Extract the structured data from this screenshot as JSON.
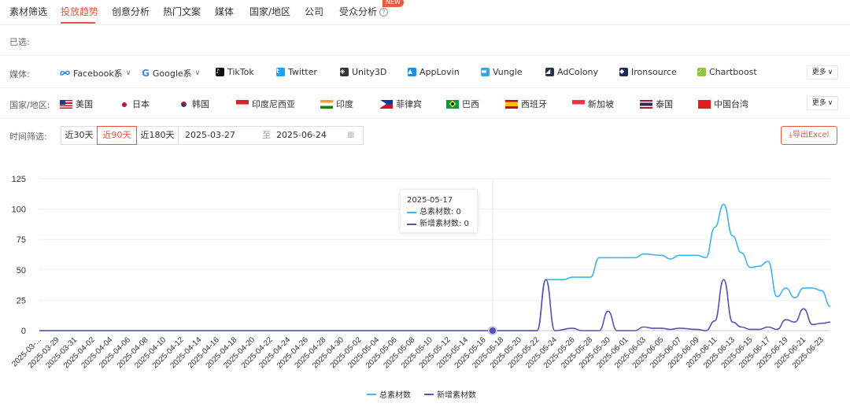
{
  "tabs": [
    {
      "label": "素材筛选"
    },
    {
      "label": "投放趋势"
    },
    {
      "label": "创意分析"
    },
    {
      "label": "热门文案"
    },
    {
      "label": "媒体"
    },
    {
      "label": "国家/地区"
    },
    {
      "label": "公司"
    },
    {
      "label": "受众分析"
    }
  ],
  "new_badge": "NEW",
  "selected_label": "已选:",
  "media": {
    "label": "媒体:",
    "items": [
      {
        "label": "Facebook系",
        "icon": "meta-icon"
      },
      {
        "label": "Google系",
        "icon": "google-icon"
      },
      {
        "label": "TikTok",
        "icon": "tiktok-icon"
      },
      {
        "label": "Twitter",
        "icon": "twitter-icon"
      },
      {
        "label": "Unity3D",
        "icon": "unity-icon"
      },
      {
        "label": "AppLovin",
        "icon": "applovin-icon"
      },
      {
        "label": "Vungle",
        "icon": "vungle-icon"
      },
      {
        "label": "AdColony",
        "icon": "adcolony-icon"
      },
      {
        "label": "Ironsource",
        "icon": "ironsource-icon"
      },
      {
        "label": "Chartboost",
        "icon": "chartboost-icon"
      }
    ],
    "more": "更多"
  },
  "country": {
    "label": "国家/地区:",
    "items": [
      {
        "label": "美国",
        "icon": "us-flag-icon"
      },
      {
        "label": "日本",
        "icon": "japan-flag-icon"
      },
      {
        "label": "韩国",
        "icon": "korea-flag-icon"
      },
      {
        "label": "印度尼西亚",
        "icon": "indonesia-flag-icon"
      },
      {
        "label": "印度",
        "icon": "india-flag-icon"
      },
      {
        "label": "菲律宾",
        "icon": "philippines-flag-icon"
      },
      {
        "label": "巴西",
        "icon": "brazil-flag-icon"
      },
      {
        "label": "西班牙",
        "icon": "spain-flag-icon"
      },
      {
        "label": "新加坡",
        "icon": "singapore-flag-icon"
      },
      {
        "label": "泰国",
        "icon": "thailand-flag-icon"
      },
      {
        "label": "中国台湾",
        "icon": "taiwan-flag-icon"
      }
    ],
    "more": "更多"
  },
  "time": {
    "label": "时间筛选:",
    "options": [
      "近30天",
      "近90天",
      "近180天"
    ],
    "selected": "近90天",
    "start_date": "2025-03-27",
    "separator": "至",
    "end_date": "2025-06-24"
  },
  "export_label": "导出Excel",
  "colors": {
    "accent": "#e8553c",
    "series_total": "#3fb4ef",
    "series_new": "#5b4fb8"
  },
  "tooltip": {
    "date": "2025-05-17",
    "rows": [
      {
        "label": "总素材数: 0",
        "color": "#3fb4ef"
      },
      {
        "label": "新增素材数: 0",
        "color": "#5b4fb8"
      }
    ]
  },
  "chart_data": {
    "type": "line",
    "x_start": "2025-03-27",
    "x_end": "2025-06-24",
    "x_tick_labels": [
      "2025-03-...",
      "2025-03-29",
      "2025-03-31",
      "2025-04-02",
      "2025-04-04",
      "2025-04-06",
      "2025-04-08",
      "2025-04-10",
      "2025-04-12",
      "2025-04-14",
      "2025-04-16",
      "2025-04-18",
      "2025-04-20",
      "2025-04-22",
      "2025-04-24",
      "2025-04-26",
      "2025-04-28",
      "2025-04-30",
      "2025-05-02",
      "2025-05-04",
      "2025-05-06",
      "2025-05-08",
      "2025-05-10",
      "2025-05-12",
      "2025-05-14",
      "2025-05-16",
      "2025-05-18",
      "2025-05-20",
      "2025-05-22",
      "2025-05-24",
      "2025-05-26",
      "2025-05-28",
      "2025-05-30",
      "2025-06-01",
      "2025-06-03",
      "2025-06-05",
      "2025-06-07",
      "2025-06-09",
      "2025-06-11",
      "2025-06-13",
      "2025-06-15",
      "2025-06-17",
      "2025-06-19",
      "2025-06-21",
      "2025-06-23"
    ],
    "y_ticks": [
      0,
      25,
      50,
      75,
      100,
      125
    ],
    "ylim": [
      0,
      125
    ],
    "highlight_date": "2025-05-17",
    "legend_position": "bottom-center",
    "series": [
      {
        "name": "总素材数",
        "points": [
          [
            "2025-03-27",
            0
          ],
          [
            "2025-05-17",
            0
          ],
          [
            "2025-05-22",
            0
          ],
          [
            "2025-05-23",
            42
          ],
          [
            "2025-05-25",
            42
          ],
          [
            "2025-05-26",
            44
          ],
          [
            "2025-05-28",
            44
          ],
          [
            "2025-05-29",
            60
          ],
          [
            "2025-06-02",
            60
          ],
          [
            "2025-06-03",
            63
          ],
          [
            "2025-06-05",
            62
          ],
          [
            "2025-06-06",
            59
          ],
          [
            "2025-06-07",
            62
          ],
          [
            "2025-06-09",
            62
          ],
          [
            "2025-06-10",
            60
          ],
          [
            "2025-06-11",
            85
          ],
          [
            "2025-06-12",
            104
          ],
          [
            "2025-06-13",
            78
          ],
          [
            "2025-06-14",
            64
          ],
          [
            "2025-06-15",
            52
          ],
          [
            "2025-06-16",
            53
          ],
          [
            "2025-06-17",
            57
          ],
          [
            "2025-06-18",
            28
          ],
          [
            "2025-06-19",
            35
          ],
          [
            "2025-06-20",
            27
          ],
          [
            "2025-06-21",
            35
          ],
          [
            "2025-06-22",
            35
          ],
          [
            "2025-06-23",
            33
          ],
          [
            "2025-06-24",
            20
          ]
        ]
      },
      {
        "name": "新增素材数",
        "points": [
          [
            "2025-03-27",
            0
          ],
          [
            "2025-05-17",
            0
          ],
          [
            "2025-05-22",
            0
          ],
          [
            "2025-05-23",
            42
          ],
          [
            "2025-05-24",
            0
          ],
          [
            "2025-05-26",
            2
          ],
          [
            "2025-05-27",
            0
          ],
          [
            "2025-05-29",
            0
          ],
          [
            "2025-05-30",
            16
          ],
          [
            "2025-05-31",
            0
          ],
          [
            "2025-06-02",
            0
          ],
          [
            "2025-06-03",
            3
          ],
          [
            "2025-06-04",
            2
          ],
          [
            "2025-06-05",
            2
          ],
          [
            "2025-06-06",
            1
          ],
          [
            "2025-06-07",
            2
          ],
          [
            "2025-06-09",
            1
          ],
          [
            "2025-06-10",
            0
          ],
          [
            "2025-06-11",
            8
          ],
          [
            "2025-06-12",
            42
          ],
          [
            "2025-06-13",
            7
          ],
          [
            "2025-06-14",
            3
          ],
          [
            "2025-06-15",
            1
          ],
          [
            "2025-06-16",
            1
          ],
          [
            "2025-06-17",
            3
          ],
          [
            "2025-06-18",
            1
          ],
          [
            "2025-06-19",
            9
          ],
          [
            "2025-06-20",
            7
          ],
          [
            "2025-06-21",
            18
          ],
          [
            "2025-06-22",
            5
          ],
          [
            "2025-06-23",
            6
          ],
          [
            "2025-06-24",
            7
          ]
        ]
      }
    ]
  }
}
